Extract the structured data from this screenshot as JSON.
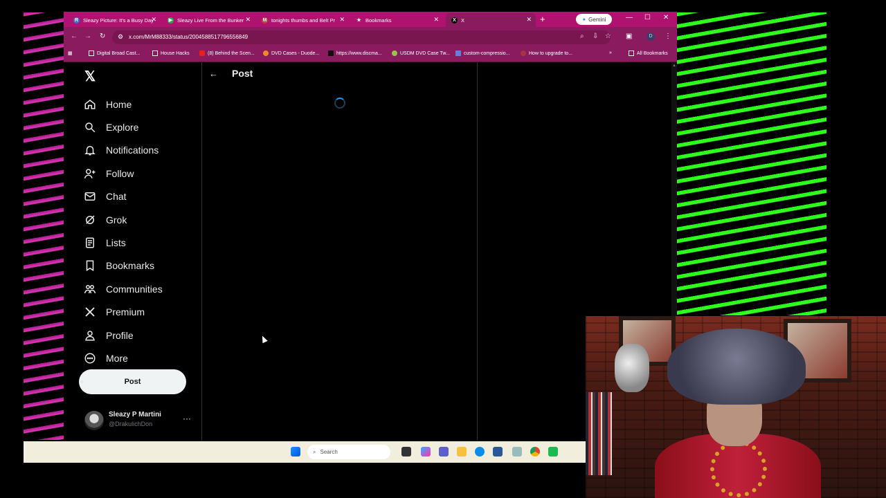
{
  "browser": {
    "tabs": [
      {
        "title": "Sleazy Picture: It's a Busy Day",
        "favicon_color": "#3b6fd6",
        "favicon_letter": "R"
      },
      {
        "title": "Sleazy Live From the Bunker",
        "favicon_color": "#2aa84a",
        "favicon_letter": "▶"
      },
      {
        "title": "tonights thumbs and Belt Pr",
        "favicon_color": "#d23c3c",
        "favicon_letter": "M"
      },
      {
        "title": "Bookmarks",
        "favicon_color": "#ffffff",
        "favicon_letter": "★"
      },
      {
        "title": "X",
        "favicon_color": "#000000",
        "favicon_letter": "X"
      }
    ],
    "gemini_label": "Gemini",
    "url": "x.com/MrM88333/status/2004588517796556849",
    "profile_initial": "D",
    "bookmarks": [
      "Digital Broad Cast...",
      "House Hacks",
      "(8) Behind the Scen...",
      "DVD Cases - Duode...",
      "https://www.discma...",
      "USDM DVD Case Tw...",
      "custom-compressio...",
      "How to upgrade to..."
    ],
    "all_bookmarks_label": "All Bookmarks"
  },
  "x": {
    "nav": [
      {
        "label": "Home",
        "icon": "home-icon"
      },
      {
        "label": "Explore",
        "icon": "search-icon"
      },
      {
        "label": "Notifications",
        "icon": "bell-icon"
      },
      {
        "label": "Follow",
        "icon": "add-person-icon"
      },
      {
        "label": "Chat",
        "icon": "mail-icon"
      },
      {
        "label": "Grok",
        "icon": "grok-icon"
      },
      {
        "label": "Lists",
        "icon": "list-icon"
      },
      {
        "label": "Bookmarks",
        "icon": "bookmark-icon"
      },
      {
        "label": "Communities",
        "icon": "communities-icon"
      },
      {
        "label": "Premium",
        "icon": "x-icon"
      },
      {
        "label": "Profile",
        "icon": "person-icon"
      },
      {
        "label": "More",
        "icon": "more-circle-icon"
      }
    ],
    "post_button": "Post",
    "account": {
      "name": "Sleazy P Martini",
      "handle": "@DrakulichDon"
    },
    "header_title": "Post"
  },
  "taskbar": {
    "search_placeholder": "Search"
  },
  "colors": {
    "tab_bar": "#b0136f",
    "toolbar": "#8a1b5e",
    "accent": "#1d9bf0",
    "stripes_left": "#d83ab5",
    "stripes_right": "#39ff26"
  }
}
